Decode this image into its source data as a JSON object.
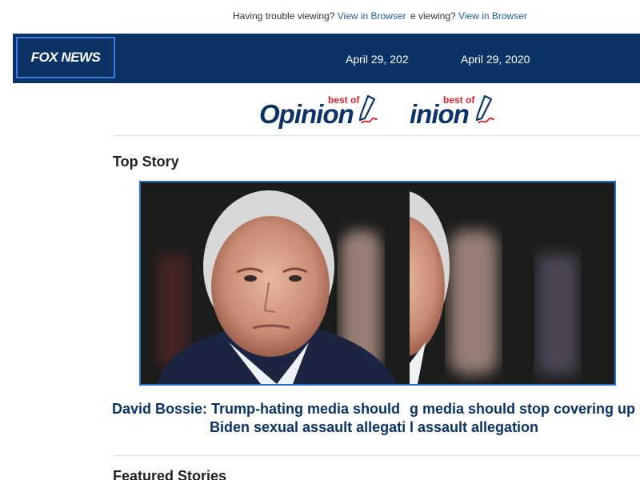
{
  "trouble_bar": {
    "text": "Having trouble viewing?",
    "link": "View in Browser",
    "right_text": "e viewing?"
  },
  "header": {
    "logo": "FOX NEWS",
    "date": "April 29, 2020",
    "date_partial": "April 29, 202"
  },
  "masthead": {
    "best_of": "best of",
    "opinion": "Opinion",
    "opinion_partial": "inion"
  },
  "top_story": {
    "section_title": "Top Story",
    "headline_line1": "David Bossie: Trump-hating media should",
    "headline_line2": "Biden sexual assault allegati",
    "headline_right_line1": "g media should stop covering up",
    "headline_right_line2": "l assault allegation"
  },
  "featured": {
    "section_title": "Featured Stories"
  },
  "colors": {
    "header_bg": "#0b3366",
    "link": "#1f5f99",
    "headline": "#0b3366",
    "accent_red": "#d8232a"
  }
}
